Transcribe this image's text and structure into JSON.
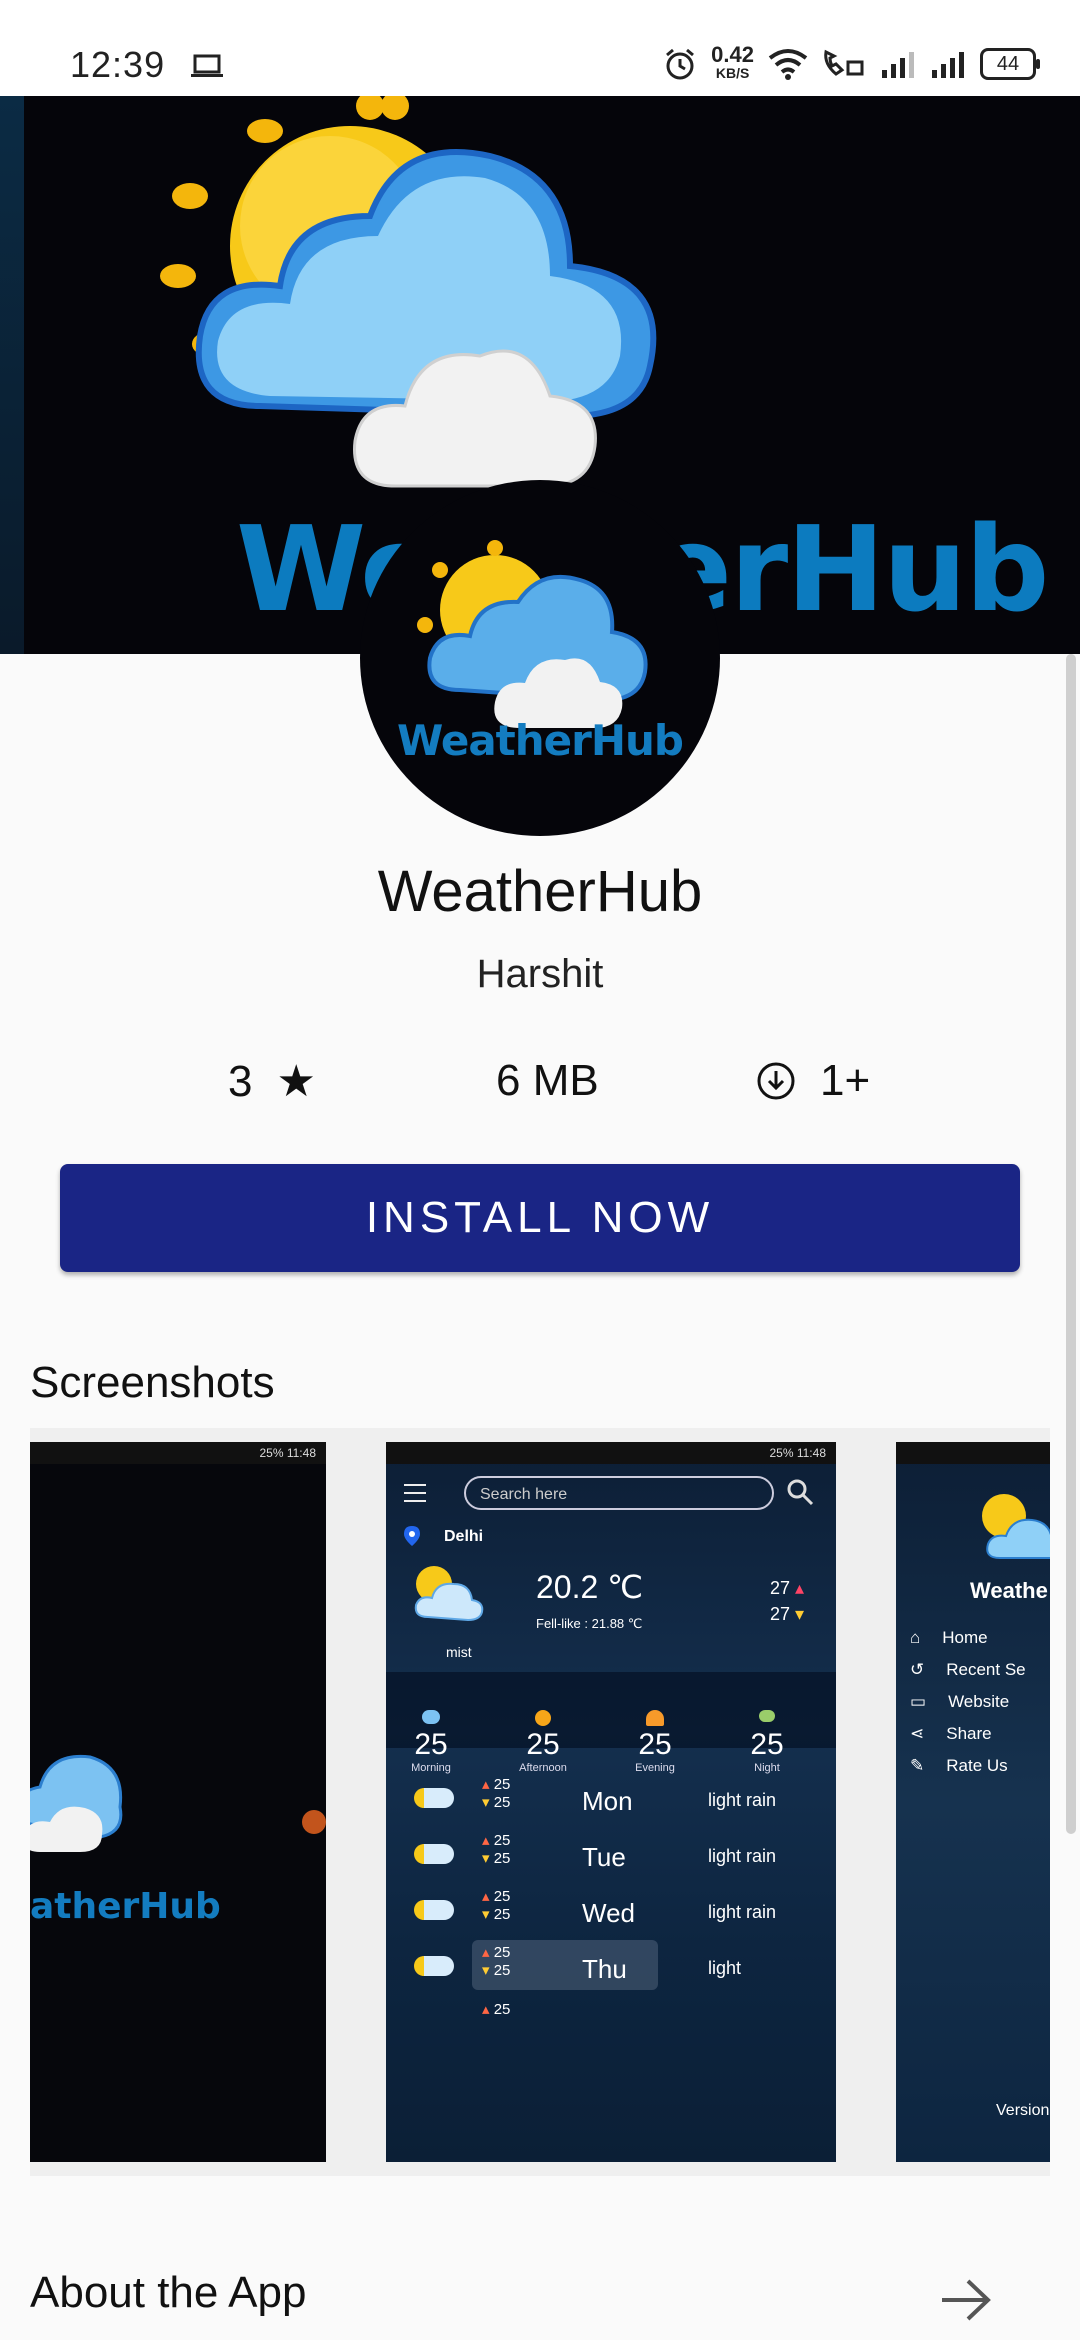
{
  "status_bar": {
    "time": "12:39",
    "net_speed": "0.42",
    "net_unit": "KB/S",
    "battery": "44",
    "icons": [
      "laptop-icon",
      "alarm-icon",
      "wifi-icon",
      "wifi-calling-icon",
      "signal-icon",
      "signal-icon"
    ]
  },
  "banner": {
    "title": "WeatherHub"
  },
  "logo": {
    "text": "WeatherHub"
  },
  "app": {
    "name": "WeatherHub",
    "developer": "Harshit"
  },
  "stats": {
    "rating": "3",
    "rating_icon": "star-icon",
    "size": "6 MB",
    "downloads": "1+",
    "downloads_icon": "download-circle-icon"
  },
  "install": {
    "label": "INSTALL NOW"
  },
  "screenshots_section": {
    "title": "Screenshots"
  },
  "screenshots": {
    "shot1": {
      "status": "25% 11:48",
      "brand": "atherHub"
    },
    "shot2": {
      "status": "25% 11:48",
      "search_placeholder": "Search here",
      "city": "Delhi",
      "temp": "20.2 ℃",
      "feels": "Fell-like : 21.88 ℃",
      "condition": "mist",
      "high": "27",
      "low": "27",
      "periods": [
        {
          "temp": "25",
          "label": "Morning"
        },
        {
          "temp": "25",
          "label": "Afternoon"
        },
        {
          "temp": "25",
          "label": "Evening"
        },
        {
          "temp": "25",
          "label": "Night"
        }
      ],
      "days": [
        {
          "day": "Mon",
          "hi": "25",
          "lo": "25",
          "desc": "light rain"
        },
        {
          "day": "Tue",
          "hi": "25",
          "lo": "25",
          "desc": "light rain"
        },
        {
          "day": "Wed",
          "hi": "25",
          "lo": "25",
          "desc": "light rain"
        },
        {
          "day": "Thu",
          "hi": "25",
          "lo": "25",
          "desc": "light"
        }
      ],
      "more_hi": "25"
    },
    "shot3": {
      "brand": "Weathe",
      "menu": [
        "Home",
        "Recent Se",
        "Website",
        "Share",
        "Rate Us"
      ],
      "footer": "Version"
    }
  },
  "about": {
    "title": "About the App"
  },
  "colors": {
    "primary": "#1a2585",
    "brand_blue": "#0c7bbf",
    "banner_bg": "#05050a"
  }
}
